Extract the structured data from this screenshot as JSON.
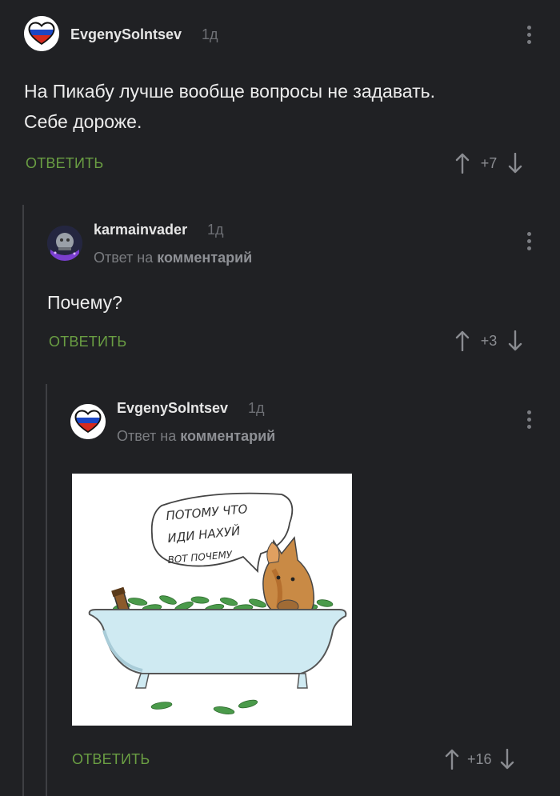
{
  "comments": [
    {
      "author": "EvgenySolntsev",
      "time": "1д",
      "text_lines": [
        "На Пикабу лучше вообще вопросы не задавать.",
        "Себе дороже."
      ],
      "reply_label": "ОТВЕТИТЬ",
      "score": "+7",
      "avatar_icon": "russia-heart-avatar-icon"
    },
    {
      "author": "karmainvader",
      "time": "1д",
      "reply_to_prefix": "Ответ на",
      "reply_to_target": "комментарий",
      "text": "Почему?",
      "reply_label": "ОТВЕТИТЬ",
      "score": "+3",
      "avatar_icon": "space-invader-avatar-icon"
    },
    {
      "author": "EvgenySolntsev",
      "time": "1д",
      "reply_to_prefix": "Ответ на",
      "reply_to_target": "комментарий",
      "picture": {
        "speech_lines": [
          "ПОТОМУ ЧТО",
          "ИДИ НАХУЙ",
          "ВОТ ПОЧЕМУ"
        ],
        "icon": "horse-in-bathtub-with-money-illustration"
      },
      "reply_label": "ОТВЕТИТЬ",
      "score": "+16",
      "avatar_icon": "russia-heart-avatar-icon"
    }
  ],
  "colors": {
    "background": "#202124",
    "reply_green": "#6a9e43",
    "thread_line": "#3e3f43"
  }
}
